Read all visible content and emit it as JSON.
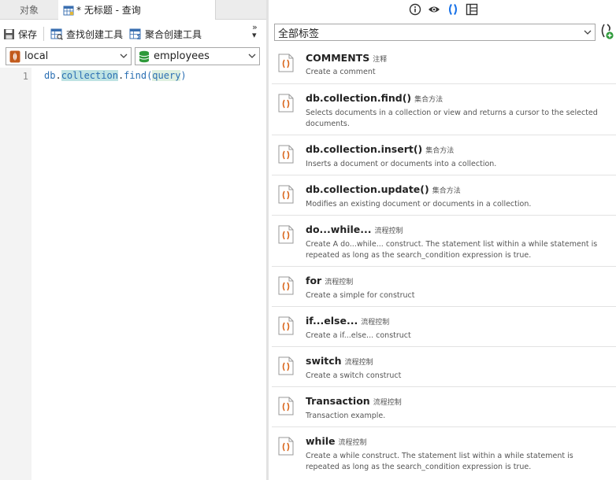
{
  "left_tabs": {
    "objects": "对象",
    "query": "* 无标题 - 查询"
  },
  "toolbar": {
    "save": "保存",
    "find_builder": "查找创建工具",
    "aggregate_builder": "聚合创建工具",
    "more": "»"
  },
  "connection": {
    "value": "local"
  },
  "database": {
    "value": "employees"
  },
  "editor": {
    "line_number": "1",
    "tokens": {
      "db": "db",
      "dot1": ".",
      "collection": "collection",
      "dot2": ".",
      "fn": "find(",
      "arg": "query",
      "close": ")"
    }
  },
  "right": {
    "tag_filter": "全部标签",
    "snippets": [
      {
        "title": "COMMENTS",
        "tag": "注释",
        "desc": "Create a comment"
      },
      {
        "title": "db.collection.find()",
        "tag": "集合方法",
        "desc": "Selects documents in a collection or view and returns a cursor to the selected documents."
      },
      {
        "title": "db.collection.insert()",
        "tag": "集合方法",
        "desc": "Inserts a document or documents into a collection."
      },
      {
        "title": "db.collection.update()",
        "tag": "集合方法",
        "desc": "Modifies an existing document or documents in a collection."
      },
      {
        "title": "do...while...",
        "tag": "流程控制",
        "desc": "Create A do...while... construct. The statement list within a while statement is repeated as long as the search_condition expression is true."
      },
      {
        "title": "for",
        "tag": "流程控制",
        "desc": "Create a simple for construct"
      },
      {
        "title": "if...else...",
        "tag": "流程控制",
        "desc": "Create a if...else... construct"
      },
      {
        "title": "switch",
        "tag": "流程控制",
        "desc": "Create a switch construct"
      },
      {
        "title": "Transaction",
        "tag": "流程控制",
        "desc": "Transaction example."
      },
      {
        "title": "while",
        "tag": "流程控制",
        "desc": "Create a while construct. The statement list within a while statement is repeated as long as the search_condition expression is true."
      }
    ]
  },
  "colors": {
    "accent": "#1a73e8",
    "snippet_icon": "#d9661c",
    "db_green": "#2e9a3a",
    "mongo_leaf": "#c25a1b"
  }
}
